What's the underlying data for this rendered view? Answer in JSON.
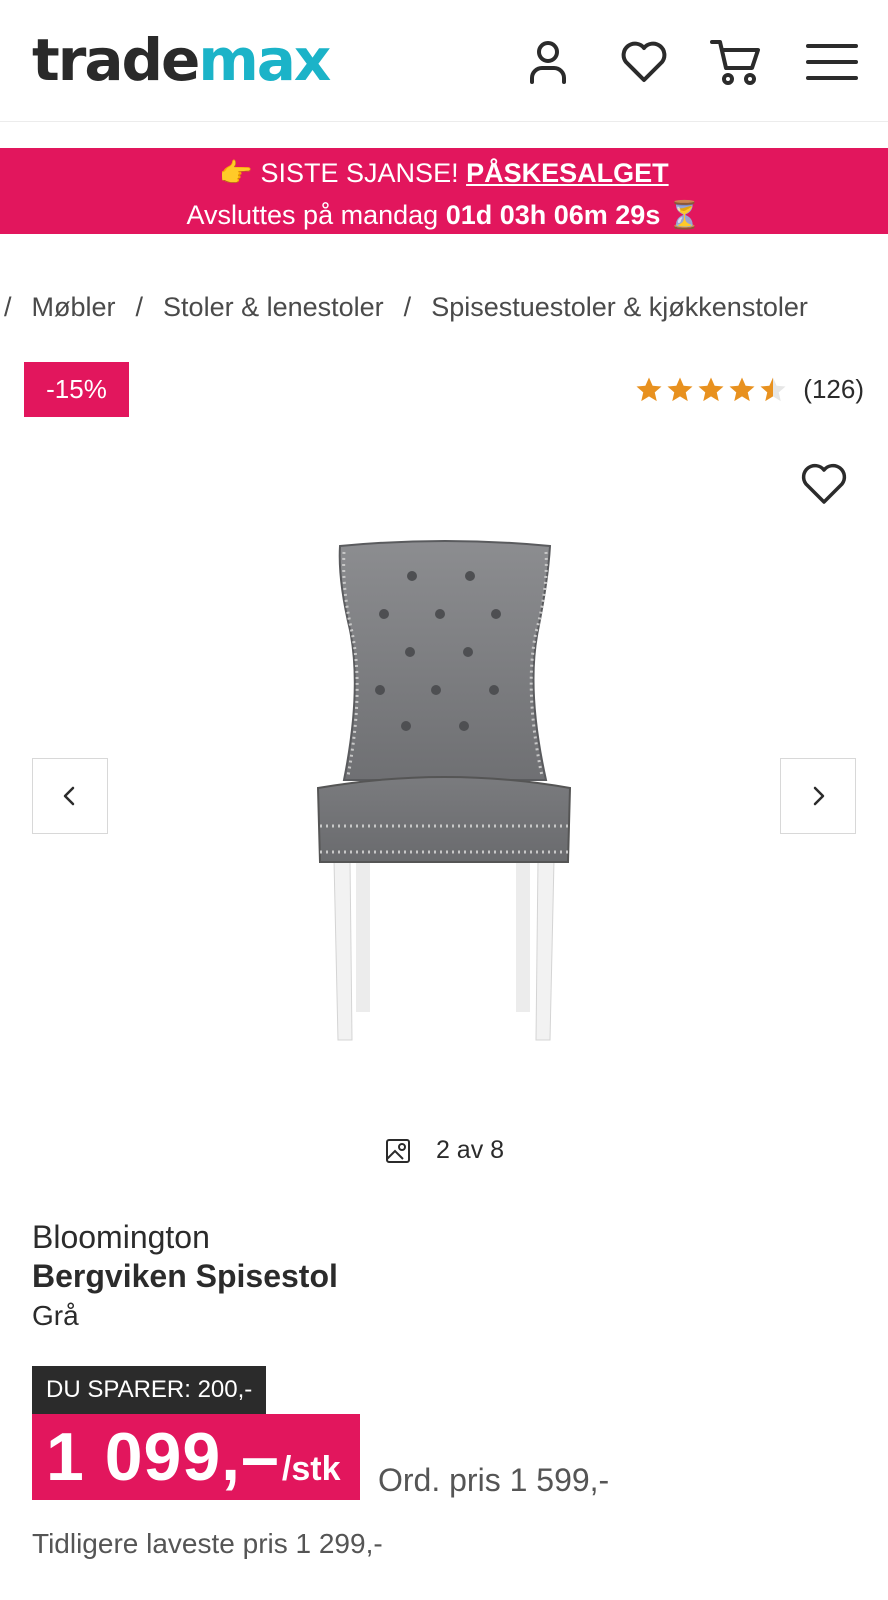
{
  "header": {
    "logo_part1": "trade",
    "logo_part2": "max",
    "icons": [
      "user-icon",
      "heart-icon",
      "cart-icon",
      "menu-icon"
    ]
  },
  "banner": {
    "emoji": "👉",
    "prefix": "SISTE SJANSE!",
    "link": "PÅSKESALGET",
    "ends_label": "Avsluttes på mandag",
    "countdown": "01d 03h 06m 29s",
    "hourglass": "⏳"
  },
  "breadcrumb": [
    "Møbler",
    "Stoler & lenestoler",
    "Spisestuestoler & kjøkkenstoler"
  ],
  "discount_badge": "-15%",
  "rating": {
    "value": 4.5,
    "count": "(126)"
  },
  "gallery": {
    "counter": "2 av 8"
  },
  "product": {
    "brand": "Bloomington",
    "name": "Bergviken Spisestol",
    "variant": "Grå"
  },
  "pricing": {
    "save_label": "DU SPARER: 200,-",
    "price": "1 099,–",
    "unit": "/stk",
    "ordinary": "Ord. pris 1 599,-",
    "lowest": "Tidligere laveste pris 1 299,-"
  },
  "colors": {
    "brand_pink": "#e2165d",
    "logo_teal": "#1bb3c8",
    "star": "#e8911f"
  }
}
